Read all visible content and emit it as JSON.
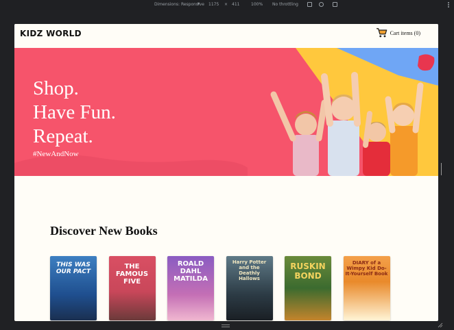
{
  "devtools": {
    "dimensions": "Dimensions: Responsive",
    "width": "1175",
    "separator": "×",
    "height": "411",
    "zoom": "100%",
    "throttle": "No throttling"
  },
  "header": {
    "logo": "KIDZ WORLD",
    "cart_label": "Cart items (0)"
  },
  "hero": {
    "lines": [
      "Shop.",
      "Have Fun.",
      "Repeat."
    ],
    "hashtag": "#NewAndNow",
    "colors": {
      "background": "#f6546b",
      "yellow": "#ffc83d",
      "blue": "#6fa6f5"
    }
  },
  "section": {
    "title": "Discover New Books"
  },
  "books": [
    {
      "title": "THIS WAS OUR PACT",
      "color": "#1f4f8f"
    },
    {
      "title": "THE FAMOUS FIVE",
      "color": "#c9475a"
    },
    {
      "title": "ROALD DAHL MATILDA",
      "color": "#7b4fa8"
    },
    {
      "title": "Harry Potter and the Deathly Hallows",
      "color": "#2c3b45"
    },
    {
      "title": "RUSKIN BOND",
      "color": "#3c6b2f"
    },
    {
      "title": "DIARY of a Wimpy Kid Do-It-Yourself Book",
      "color": "#e98a2b"
    }
  ]
}
